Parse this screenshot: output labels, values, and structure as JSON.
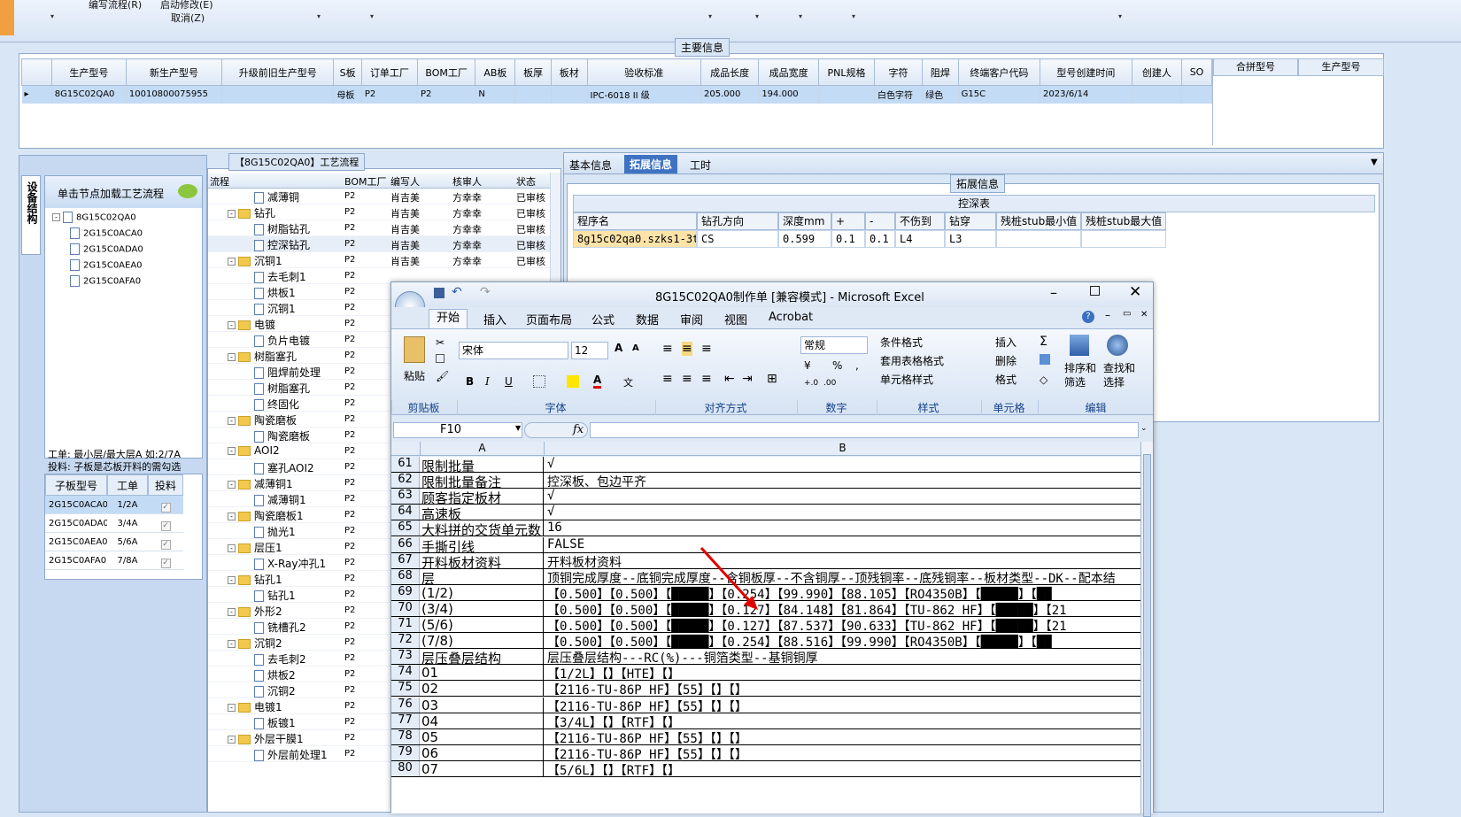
{
  "topbar": {
    "menu": [
      "编写流程(R)",
      "启动修改(E)",
      "取消(Z)"
    ]
  },
  "main_info": {
    "title": "主要信息",
    "columns": [
      "生产型号",
      "新生产型号",
      "升级前旧生产型号",
      "S板",
      "订单工厂",
      "BOM工厂",
      "AB板",
      "板厚",
      "板材",
      "验收标准",
      "成品长度",
      "成品宽度",
      "PNL规格",
      "字符",
      "阻焊",
      "终端客户代码",
      "型号创建时间",
      "创建人",
      "SO"
    ],
    "row": [
      "8G15C02QA0",
      "10010800075955",
      "",
      "母板",
      "P2",
      "P2",
      "N",
      "",
      "",
      "IPC-6018 II 级",
      "205.000",
      "194.000",
      "",
      "白色字符",
      "绿色",
      "G15C",
      "2023/6/14",
      "",
      ""
    ],
    "side_columns": [
      "合拼型号",
      "生产型号"
    ]
  },
  "left_panel": {
    "vertical_tab": "设备结构",
    "hint": "单击节点加载工艺流程",
    "tree_root": "8G15C02QA0",
    "tree_children": [
      "2G15C0ACA0",
      "2G15C0ADA0",
      "2G15C0AEA0",
      "2G15C0AFA0"
    ],
    "note1": "工单: 最小层/最大层A 如:2/7A",
    "note2": "投料: 子板是芯板开料的需勾选",
    "sub_columns": [
      "子板型号",
      "工单",
      "投料"
    ],
    "sub_rows": [
      [
        "2G15C0ACA0",
        "1/2A"
      ],
      [
        "2G15C0ADA0",
        "3/4A"
      ],
      [
        "2G15C0AEA0",
        "5/6A"
      ],
      [
        "2G15C0AFA0",
        "7/8A"
      ]
    ]
  },
  "flow": {
    "title": "【8G15C02QA0】工艺流程",
    "columns": [
      "流程",
      "BOM工厂",
      "编写人",
      "核审人",
      "状态"
    ],
    "rows": [
      {
        "l": 1,
        "t": "减薄铜",
        "f": "P2",
        "w": "肖吉美",
        "r": "方幸幸",
        "s": "已审核"
      },
      {
        "l": 0,
        "t": "钻孔",
        "f": "P2",
        "w": "肖吉美",
        "r": "方幸幸",
        "s": "已审核"
      },
      {
        "l": 1,
        "t": "树脂钻孔",
        "f": "P2",
        "w": "肖吉美",
        "r": "方幸幸",
        "s": "已审核"
      },
      {
        "l": 1,
        "t": "控深钻孔",
        "f": "P2",
        "w": "肖吉美",
        "r": "方幸幸",
        "s": "已审核"
      },
      {
        "l": 0,
        "t": "沉铜1",
        "f": "P2",
        "w": "肖吉美",
        "r": "方幸幸",
        "s": "已审核"
      },
      {
        "l": 1,
        "t": "去毛刺1",
        "f": "P2",
        "w": "",
        "r": "",
        "s": ""
      },
      {
        "l": 1,
        "t": "烘板1",
        "f": "P2",
        "w": "",
        "r": "",
        "s": ""
      },
      {
        "l": 1,
        "t": "沉铜1",
        "f": "P2",
        "w": "",
        "r": "",
        "s": ""
      },
      {
        "l": 0,
        "t": "电镀",
        "f": "P2",
        "w": "",
        "r": "",
        "s": ""
      },
      {
        "l": 1,
        "t": "负片电镀",
        "f": "P2",
        "w": "",
        "r": "",
        "s": ""
      },
      {
        "l": 0,
        "t": "树脂塞孔",
        "f": "P2",
        "w": "",
        "r": "",
        "s": ""
      },
      {
        "l": 1,
        "t": "阻焊前处理",
        "f": "P2",
        "w": "",
        "r": "",
        "s": ""
      },
      {
        "l": 1,
        "t": "树脂塞孔",
        "f": "P2",
        "w": "",
        "r": "",
        "s": ""
      },
      {
        "l": 1,
        "t": "终固化",
        "f": "P2",
        "w": "",
        "r": "",
        "s": ""
      },
      {
        "l": 0,
        "t": "陶瓷磨板",
        "f": "P2",
        "w": "",
        "r": "",
        "s": ""
      },
      {
        "l": 1,
        "t": "陶瓷磨板",
        "f": "P2",
        "w": "",
        "r": "",
        "s": ""
      },
      {
        "l": 0,
        "t": "AOI2",
        "f": "P2",
        "w": "",
        "r": "",
        "s": ""
      },
      {
        "l": 1,
        "t": "塞孔AOI2",
        "f": "P2",
        "w": "",
        "r": "",
        "s": ""
      },
      {
        "l": 0,
        "t": "减薄铜1",
        "f": "P2",
        "w": "",
        "r": "",
        "s": ""
      },
      {
        "l": 1,
        "t": "减薄铜1",
        "f": "P2",
        "w": "",
        "r": "",
        "s": ""
      },
      {
        "l": 0,
        "t": "陶瓷磨板1",
        "f": "P2",
        "w": "",
        "r": "",
        "s": ""
      },
      {
        "l": 1,
        "t": "抛光1",
        "f": "P2",
        "w": "",
        "r": "",
        "s": ""
      },
      {
        "l": 0,
        "t": "层压1",
        "f": "P2",
        "w": "",
        "r": "",
        "s": ""
      },
      {
        "l": 1,
        "t": "X-Ray冲孔1",
        "f": "P2",
        "w": "",
        "r": "",
        "s": ""
      },
      {
        "l": 0,
        "t": "钻孔1",
        "f": "P2",
        "w": "",
        "r": "",
        "s": ""
      },
      {
        "l": 1,
        "t": "钻孔1",
        "f": "P2",
        "w": "",
        "r": "",
        "s": ""
      },
      {
        "l": 0,
        "t": "外形2",
        "f": "P2",
        "w": "",
        "r": "",
        "s": ""
      },
      {
        "l": 1,
        "t": "铣槽孔2",
        "f": "P2",
        "w": "",
        "r": "",
        "s": ""
      },
      {
        "l": 0,
        "t": "沉铜2",
        "f": "P2",
        "w": "",
        "r": "",
        "s": ""
      },
      {
        "l": 1,
        "t": "去毛刺2",
        "f": "P2",
        "w": "",
        "r": "",
        "s": ""
      },
      {
        "l": 1,
        "t": "烘板2",
        "f": "P2",
        "w": "",
        "r": "",
        "s": ""
      },
      {
        "l": 1,
        "t": "沉铜2",
        "f": "P2",
        "w": "",
        "r": "",
        "s": ""
      },
      {
        "l": 0,
        "t": "电镀1",
        "f": "P2",
        "w": "",
        "r": "",
        "s": ""
      },
      {
        "l": 1,
        "t": "板镀1",
        "f": "P2",
        "w": "",
        "r": "",
        "s": ""
      },
      {
        "l": 0,
        "t": "外层干膜1",
        "f": "P2",
        "w": "",
        "r": "",
        "s": ""
      },
      {
        "l": 1,
        "t": "外层前处理1",
        "f": "P2",
        "w": "",
        "r": "",
        "s": ""
      }
    ]
  },
  "right_panel": {
    "tabs": [
      "基本信息",
      "拓展信息",
      "工时"
    ],
    "group": "拓展信息",
    "table_title": "控深表",
    "columns": [
      "程序名",
      "钻孔方向",
      "深度mm",
      "+",
      "-",
      "不伤到",
      "钻穿",
      "残桩stub最小值",
      "残桩stub最大值"
    ],
    "row": [
      "8g15c02qa0.szks1-3t",
      "CS",
      "0.599",
      "0.1",
      "0.1",
      "L4",
      "L3",
      "",
      ""
    ]
  },
  "excel": {
    "title": "8G15C02QA0制作单 [兼容模式] - Microsoft Excel",
    "tabs": [
      "开始",
      "插入",
      "页面布局",
      "公式",
      "数据",
      "审阅",
      "视图",
      "Acrobat"
    ],
    "font_name": "宋体",
    "font_size": "12",
    "number_format": "常规",
    "groups": [
      "剪贴板",
      "字体",
      "对齐方式",
      "数字",
      "样式",
      "单元格",
      "编辑"
    ],
    "paste": "粘贴",
    "cond_format": "条件格式",
    "table_format": "套用表格格式",
    "cell_style": "单元格样式",
    "insert": "插入",
    "delete": "删除",
    "format": "格式",
    "sort": "排序和\n筛选",
    "find": "查找和\n选择",
    "name_box": "F10",
    "fx": "fx",
    "col_a": "A",
    "col_b": "B",
    "rows": [
      [
        "61",
        "限制批量",
        "√"
      ],
      [
        "62",
        "限制批量备注",
        "控深板、包边平齐"
      ],
      [
        "63",
        "顾客指定板材",
        "√"
      ],
      [
        "64",
        "高速板",
        "√"
      ],
      [
        "65",
        "大料拼的交货单元数",
        "16"
      ],
      [
        "66",
        "手撕引线",
        "FALSE"
      ],
      [
        "67",
        "开料板材资料",
        "开料板材资料"
      ],
      [
        "68",
        "层",
        "顶铜完成厚度--底铜完成厚度--含铜板厚--不含铜厚--顶残铜率--底残铜率--板材类型--DK--配本结"
      ],
      [
        "69",
        "(1/2)",
        "【0.500】【0.500】【█████】【0.254】【99.990】【88.105】【RO4350B】【█████】【██"
      ],
      [
        "70",
        "(3/4)",
        "【0.500】【0.500】【█████】【0.127】【84.148】【81.864】【TU-862 HF】【█████】【21"
      ],
      [
        "71",
        "(5/6)",
        "【0.500】【0.500】【█████】【0.127】【87.537】【90.633】【TU-862 HF】【█████】【21"
      ],
      [
        "72",
        "(7/8)",
        "【0.500】【0.500】【█████】【0.254】【88.516】【99.990】【RO4350B】【█████】【██"
      ],
      [
        "73",
        "层压叠层结构",
        "层压叠层结构---RC(%)---铜箔类型--基铜铜厚"
      ],
      [
        "74",
        "01",
        "【1/2L】【】【HTE】【】"
      ],
      [
        "75",
        "02",
        "【2116-TU-86P HF】【55】【】【】"
      ],
      [
        "76",
        "03",
        "【2116-TU-86P HF】【55】【】【】"
      ],
      [
        "77",
        "04",
        "【3/4L】【】【RTF】【】"
      ],
      [
        "78",
        "05",
        "【2116-TU-86P HF】【55】【】【】"
      ],
      [
        "79",
        "06",
        "【2116-TU-86P HF】【55】【】【】"
      ],
      [
        "80",
        "07",
        "【5/6L】【】【RTF】【】"
      ]
    ]
  }
}
